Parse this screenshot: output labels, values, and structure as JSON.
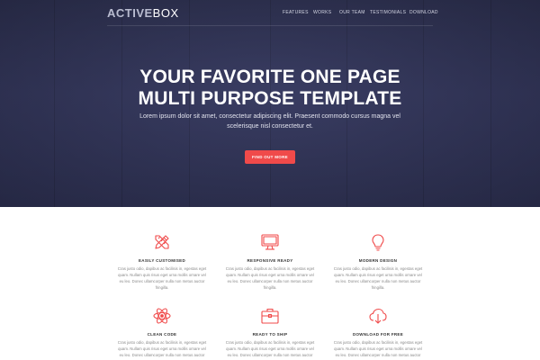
{
  "brand": {
    "part1": "ACTIVE",
    "part2": "BOX"
  },
  "nav": [
    "FEATURES",
    "WORKS",
    "OUR TEAM",
    "TESTIMONIALS",
    "DOWNLOAD"
  ],
  "hero": {
    "title_line1": "YOUR FAVORITE ONE PAGE",
    "title_line2": "MULTI PURPOSE TEMPLATE",
    "subtitle_line1": "Lorem ipsum dolor sit amet, consectetur adipiscing elit. Praesent commodo cursus magna vel",
    "subtitle_line2": "scelerisque nisl consectetur et.",
    "cta": "FIND OUT MORE"
  },
  "features": [
    {
      "icon": "pencil-ruler-icon",
      "title": "EASILY CUSTOMISED",
      "lines": [
        "Cras justo odio, dapibus ac facilisis in, egestas eget",
        "quam. Nullam quis risus eget urna mollis ornare vel",
        "eu leo. Donec ullamcorper nulla non metus auctor",
        "fringilla."
      ]
    },
    {
      "icon": "monitor-icon",
      "title": "RESPONSIVE READY",
      "lines": [
        "Cras justo odio, dapibus ac facilisis in, egestas eget",
        "quam. Nullam quis risus eget urna mollis ornare vel",
        "eu leo. Donec ullamcorper nulla non metus auctor",
        "fringilla."
      ]
    },
    {
      "icon": "lightbulb-icon",
      "title": "MODERN DESIGN",
      "lines": [
        "Cras justo odio, dapibus ac facilisis in, egestas eget",
        "quam. Nullam quis risus eget urna mollis ornare vel",
        "eu leo. Donec ullamcorper nulla non metus auctor",
        "fringilla."
      ]
    },
    {
      "icon": "atom-icon",
      "title": "CLEAN CODE",
      "lines": [
        "Cras justo odio, dapibus ac facilisis in, egestas eget",
        "quam. Nullam quis risus eget urna mollis ornare vel",
        "eu leo. Donec ullamcorper nulla non metus auctor"
      ]
    },
    {
      "icon": "briefcase-icon",
      "title": "READY TO SHIP",
      "lines": [
        "Cras justo odio, dapibus ac facilisis in, egestas eget",
        "quam. Nullam quis risus eget urna mollis ornare vel",
        "eu leo. Donec ullamcorper nulla non metus auctor"
      ]
    },
    {
      "icon": "cloud-download-icon",
      "title": "DOWNLOAD FOR FREE",
      "lines": [
        "Cras justo odio, dapibus ac facilisis in, egestas eget",
        "quam. Nullam quis risus eget urna mollis ornare vel",
        "eu leo. Donec ullamcorper nulla non metus auctor"
      ]
    }
  ],
  "colors": {
    "accent": "#f04a4a",
    "hero_bg": "#2f3252"
  }
}
